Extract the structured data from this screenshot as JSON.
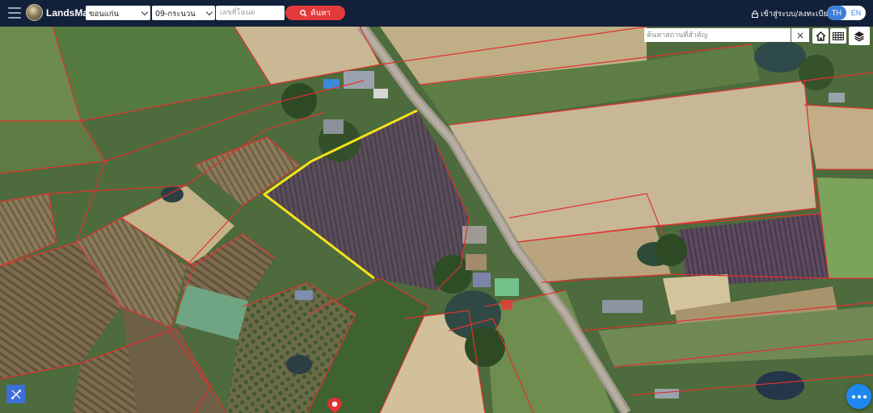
{
  "app": {
    "name": "LandsMaps"
  },
  "header": {
    "province_select": "ขอนแก่น",
    "district_select": "09-กระนวน",
    "deed_input_placeholder": "เลขที่โฉนด",
    "search_button_label": "ค้นหา",
    "login_label": "เข้าสู่ระบบ/ลงทะเบียน",
    "lang_th": "TH",
    "lang_en": "EN",
    "lang_active": "TH"
  },
  "map": {
    "place_search_placeholder": "ค้นหาสถานที่สำคัญ",
    "clear_symbol": "×",
    "icons": [
      "home-icon",
      "grid-icon",
      "layers-icon",
      "measure-tool-icon",
      "chat-icon",
      "location-pin-icon"
    ],
    "colors": {
      "parcel_boundary": "#e0322f",
      "selected_parcel": "#f4e21c",
      "search_button": "#e23b3b",
      "accent": "#3d7fd6"
    }
  }
}
